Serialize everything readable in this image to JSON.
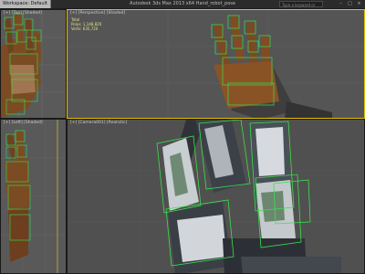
{
  "workspace_button": "Workspace: Default",
  "app_title": "Autodesk 3ds Max 2013 x64   Hand_robot_pose",
  "search_placeholder": "Type a keyword or phrase",
  "viewports": {
    "top_left": {
      "label": "[+] [Top] [Shaded]"
    },
    "perspective": {
      "label": "[+] [Perspective] [Shaded]",
      "stats": {
        "total": "Total",
        "polys": "Polys:   1,148,820",
        "verts": "Verts:    635,720"
      }
    },
    "bottom_left": {
      "label": "[+] [Left] [Shaded]"
    },
    "camera": {
      "label": "[+] [Camera001] [Realistic]"
    }
  },
  "colors": {
    "grid_bg": "#595959",
    "wire_green": "#39e24a",
    "copper": "#8a5326",
    "metal_light": "#c9ced3",
    "metal_dark": "#3c4149"
  }
}
